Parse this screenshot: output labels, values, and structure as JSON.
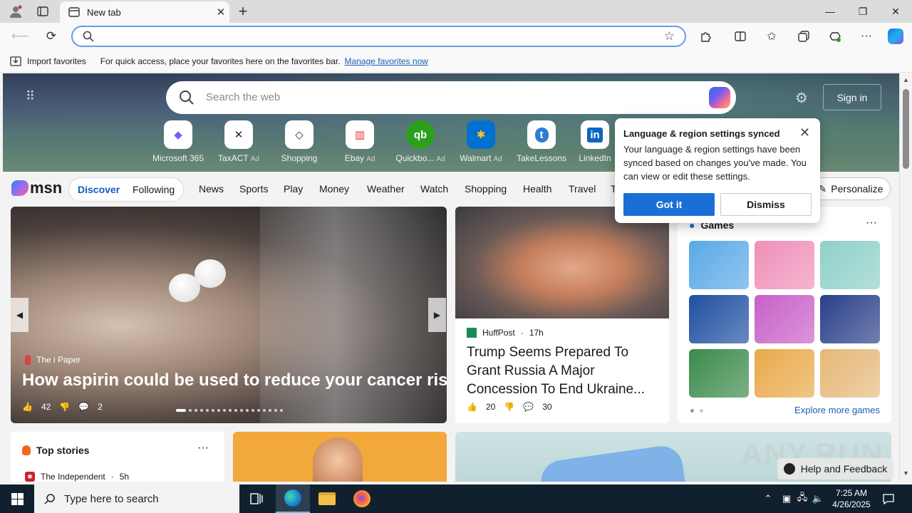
{
  "browser": {
    "tab_title": "New tab",
    "tab_close": "✕",
    "new_tab": "+",
    "window_controls": {
      "minimize": "—",
      "restore": "❐",
      "close": "✕"
    },
    "address_value": "",
    "icons": [
      "profile-icon",
      "tab-actions-icon",
      "back-icon",
      "refresh-icon",
      "favorite-star-icon",
      "extensions-icon",
      "split-screen-icon",
      "favorites-icon",
      "collections-icon",
      "performance-icon",
      "more-icon",
      "copilot-icon"
    ]
  },
  "favorites_bar": {
    "import_label": "Import favorites",
    "hint": "For quick access, place your favorites here on the favorites bar.",
    "manage_link": "Manage favorites now"
  },
  "hero": {
    "search_placeholder": "Search the web",
    "sign_in": "Sign in",
    "quick_links": [
      {
        "label": "Microsoft 365",
        "ad": "",
        "tile_text": "◆",
        "color": "#7b5cf0"
      },
      {
        "label": "TaxACT",
        "ad": "Ad",
        "tile_text": "✕",
        "color": "#1b2a44"
      },
      {
        "label": "Shopping",
        "ad": "",
        "tile_text": "◇",
        "color": "#333333"
      },
      {
        "label": "Ebay",
        "ad": "Ad",
        "tile_text": "▥",
        "color": "#e53238"
      },
      {
        "label": "Quickbo...",
        "ad": "Ad",
        "tile_text": "qb",
        "color": "#2ca01c"
      },
      {
        "label": "Walmart",
        "ad": "Ad",
        "tile_text": "✱",
        "color": "#0071ce"
      },
      {
        "label": "TakeLessons",
        "ad": "",
        "tile_text": "t",
        "color": "#2d7dd2"
      },
      {
        "label": "LinkedIn",
        "ad": "",
        "tile_text": "in",
        "color": "#0a66c2"
      }
    ]
  },
  "msn_nav": {
    "logo": "msn",
    "discover": "Discover",
    "following": "Following",
    "items": [
      "News",
      "Sports",
      "Play",
      "Money",
      "Weather",
      "Watch",
      "Shopping",
      "Health",
      "Travel",
      "T"
    ],
    "personalize": "Personalize"
  },
  "carousel": {
    "source": "The i Paper",
    "title": "How aspirin could be used to reduce your cancer risk",
    "likes": "42",
    "comments": "2",
    "slide_count": 18,
    "active_slide": 2
  },
  "news_card": {
    "source": "HuffPost",
    "age": "17h",
    "title": "Trump Seems Prepared To Grant Russia A Major Concession To End Ukraine...",
    "likes": "20",
    "comments": "30"
  },
  "games": {
    "heading": "Games",
    "more": "···",
    "explore": "Explore more games",
    "tiles": [
      {
        "name": "game-tile-1",
        "color": "#5aa9e6"
      },
      {
        "name": "game-tile-2",
        "color": "#f08fb8"
      },
      {
        "name": "game-tile-3",
        "color": "#8fd0c8"
      },
      {
        "name": "game-tile-4",
        "color": "#1f4fa0"
      },
      {
        "name": "game-tile-5",
        "color": "#c860c8"
      },
      {
        "name": "game-tile-6",
        "color": "#2a3f8a"
      },
      {
        "name": "game-tile-7",
        "color": "#3a8a4a"
      },
      {
        "name": "game-tile-8",
        "color": "#e8a94a"
      },
      {
        "name": "game-tile-9",
        "color": "#e6b878"
      }
    ]
  },
  "top_stories": {
    "heading": "Top stories",
    "more": "···",
    "source": "The Independent",
    "age": "5h"
  },
  "popup": {
    "title": "Language & region settings synced",
    "body": "Your language & region settings have been synced based on changes you've made. You can view or edit these settings.",
    "confirm": "Got it",
    "dismiss": "Dismiss"
  },
  "help": {
    "label": "Help and Feedback"
  },
  "watermark": "ANY.RUN",
  "taskbar": {
    "search_placeholder": "Type here to search",
    "time": "7:25 AM",
    "date": "4/26/2025"
  }
}
